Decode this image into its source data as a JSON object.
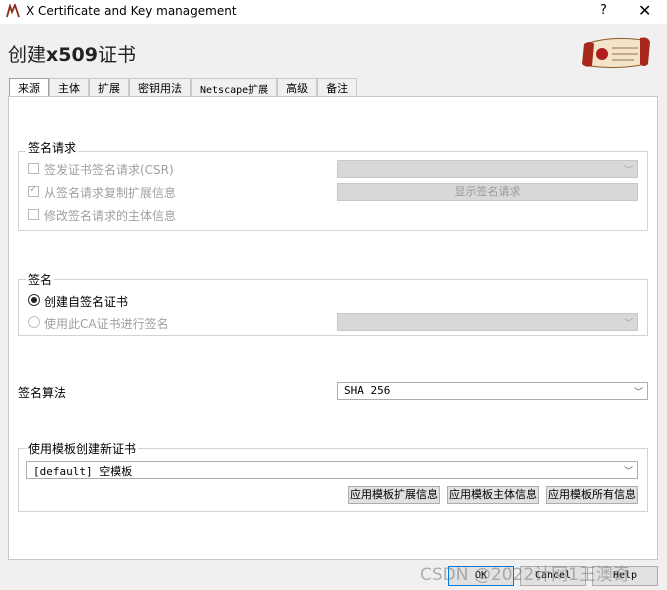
{
  "window": {
    "title": "X Certificate and Key management",
    "help": "?",
    "close": "✕"
  },
  "dialog": {
    "title_prefix": "创建",
    "title_bold": "x509",
    "title_suffix": "证书"
  },
  "tabs": [
    {
      "label": "来源",
      "active": true
    },
    {
      "label": "主体"
    },
    {
      "label": "扩展"
    },
    {
      "label": "密钥用法"
    },
    {
      "label": "Netscape扩展"
    },
    {
      "label": "高级"
    },
    {
      "label": "备注"
    }
  ],
  "sign_request": {
    "heading": "签名请求",
    "opt_sign_csr": "签发证书签名请求(CSR)",
    "opt_copy_ext": "从签名请求复制扩展信息",
    "opt_modify_subject": "修改签名请求的主体信息",
    "show_request_button": "显示签名请求"
  },
  "signing": {
    "heading": "签名",
    "opt_self_signed": "创建自签名证书",
    "opt_use_ca": "使用此CA证书进行签名"
  },
  "algorithm": {
    "label": "签名算法",
    "value": "SHA 256"
  },
  "template": {
    "heading": "使用模板创建新证书",
    "value": "[default] 空模板",
    "apply_ext": "应用模板扩展信息",
    "apply_subject": "应用模板主体信息",
    "apply_all": "应用模板所有信息"
  },
  "footer": {
    "ok": "OK",
    "cancel": "Cancel",
    "help": "Help"
  },
  "watermark": "CSDN @2022计网1王澳奇"
}
